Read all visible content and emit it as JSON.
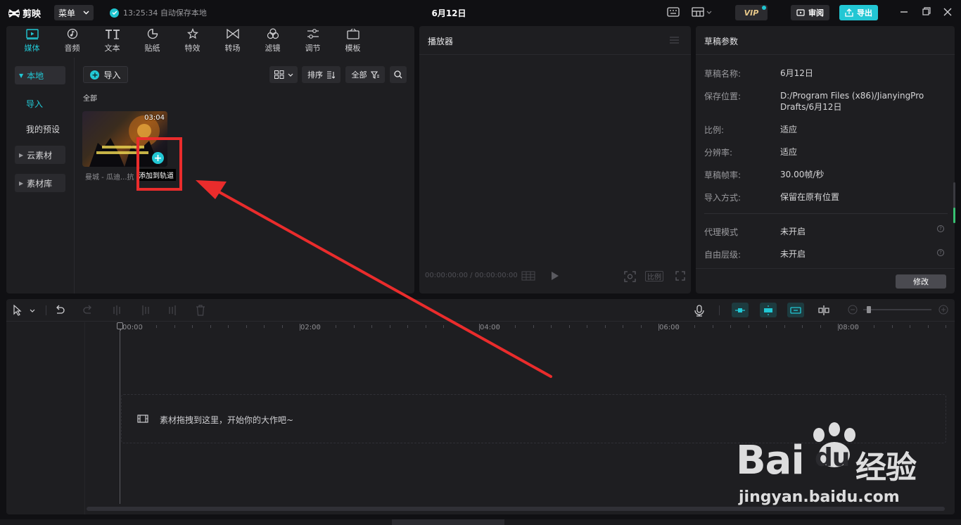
{
  "app": {
    "logo_text": "剪映",
    "menu_label": "菜单",
    "autosave_text": "13:25:34 自动保存本地",
    "project_title": "6月12日",
    "vip_label": "VIP",
    "review_label": "审阅",
    "export_label": "导出"
  },
  "media_tabs": [
    {
      "label": "媒体",
      "icon": "media-icon",
      "active": true
    },
    {
      "label": "音频",
      "icon": "audio-icon"
    },
    {
      "label": "文本",
      "icon": "text-icon"
    },
    {
      "label": "贴纸",
      "icon": "sticker-icon"
    },
    {
      "label": "特效",
      "icon": "effects-icon"
    },
    {
      "label": "转场",
      "icon": "transition-icon"
    },
    {
      "label": "滤镜",
      "icon": "filter-icon"
    },
    {
      "label": "调节",
      "icon": "adjust-icon"
    },
    {
      "label": "模板",
      "icon": "template-icon"
    }
  ],
  "sidebar": {
    "local": "本地",
    "import": "导入",
    "presets": "我的预设",
    "cloud": "云素材",
    "library": "素材库"
  },
  "media_toolbar": {
    "import_label": "导入",
    "sort_label": "排序",
    "filter_label": "全部",
    "section_label": "全部"
  },
  "media_items": [
    {
      "name": "曼城 - 瓜迪...抗",
      "duration": "03:04",
      "tooltip": "添加到轨道"
    }
  ],
  "player": {
    "title": "播放器",
    "timecode": "00:00:00:00 / 00:00:00:00",
    "ratio_label": "比例"
  },
  "params": {
    "title": "草稿参数",
    "rows": [
      {
        "label": "草稿名称:",
        "value": "6月12日"
      },
      {
        "label": "保存位置:",
        "value": "D:/Program Files (x86)/JianyingPro Drafts/6月12日"
      },
      {
        "label": "比例:",
        "value": "适应"
      },
      {
        "label": "分辨率:",
        "value": "适应"
      },
      {
        "label": "草稿帧率:",
        "value": "30.00帧/秒"
      },
      {
        "label": "导入方式:",
        "value": "保留在原有位置"
      },
      {
        "label": "代理模式",
        "value": "未开启"
      },
      {
        "label": "自由层级:",
        "value": "未开启"
      }
    ],
    "modify_label": "修改"
  },
  "timeline": {
    "ruler_labels": [
      "00:00",
      "02:00",
      "04:00",
      "06:00",
      "08:00"
    ],
    "drop_hint": "素材拖拽到这里，开始你的大作吧~"
  },
  "watermark": {
    "brand": "Bai",
    "brand2": "du",
    "brand_suffix": "经验",
    "url": "jingyan.baidu.com"
  },
  "colors": {
    "accent": "#22c7d4",
    "annotation": "#ea2c2c"
  }
}
